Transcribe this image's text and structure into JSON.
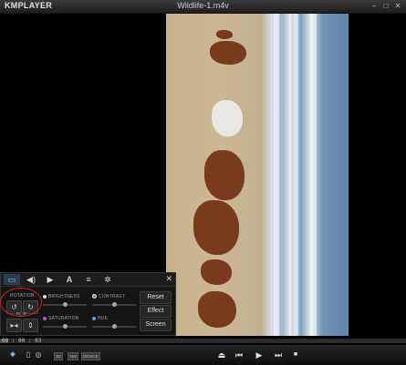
{
  "app": {
    "logo": "KMPLAYER",
    "title": "Wildlife-1.m4v"
  },
  "window_controls": [
    "minimize-icon",
    "maximize-icon",
    "close-icon"
  ],
  "panel": {
    "tabs": [
      {
        "icon": "screen-icon",
        "active": true
      },
      {
        "icon": "speaker-icon",
        "active": false
      },
      {
        "icon": "play-icon",
        "active": false
      },
      {
        "icon": "subtitle-icon",
        "active": false
      },
      {
        "icon": "playlist-icon",
        "active": false
      },
      {
        "icon": "gear-icon",
        "active": false
      }
    ],
    "rotation_label": "ROTATION",
    "flip_label": "FLIP",
    "brightness_label": "BRIGHTNESS",
    "contrast_label": "CONTRAST",
    "saturation_label": "SATURATION",
    "hue_label": "HUE",
    "brightness_level": 0.5,
    "contrast_level": 0.5,
    "saturation_level": 0.5,
    "hue_level": 0.5,
    "reset_label": "Reset",
    "effect_label": "Effect",
    "screen_label": "Screen"
  },
  "status": {
    "time": "00 : 00 : 03",
    "progress": 0.02
  },
  "bottom": {
    "badges": [
      "3D",
      "SMI",
      "DEVICE"
    ],
    "controls": [
      "eject-icon",
      "previous-icon",
      "play-icon",
      "next-icon",
      "stop-icon"
    ]
  },
  "colors": {
    "accent": "#7fb4ff",
    "annotation": "#e01818"
  }
}
